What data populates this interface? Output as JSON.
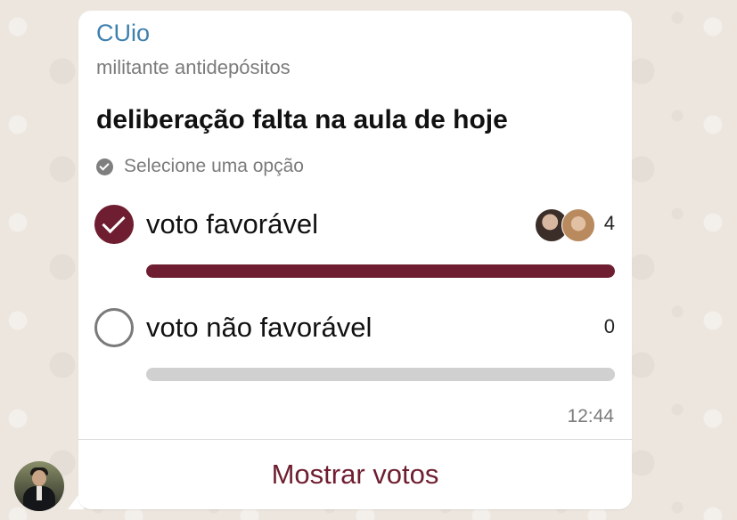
{
  "message": {
    "sender_name": "CUio",
    "sender_note": "militante antidepósitos",
    "time": "12:44"
  },
  "poll": {
    "question": "deliberação falta na aula de hoje",
    "hint": "Selecione uma opção",
    "options": [
      {
        "label": "voto favorável",
        "count": "4",
        "selected": true,
        "fill_fraction": 1.0
      },
      {
        "label": "voto não favorável",
        "count": "0",
        "selected": false,
        "fill_fraction": 0.0
      }
    ],
    "show_votes_label": "Mostrar votos"
  },
  "colors": {
    "accent": "#6E1E30",
    "sender_name": "#3E80AE",
    "bar_track": "#D0D0D0",
    "bubble": "#FFFFFF",
    "wallpaper": "#ECE6DE"
  },
  "icons": {
    "hint": "check-circle-icon",
    "selected_option": "checkmark-icon",
    "unselected_option": "empty-circle-icon"
  }
}
